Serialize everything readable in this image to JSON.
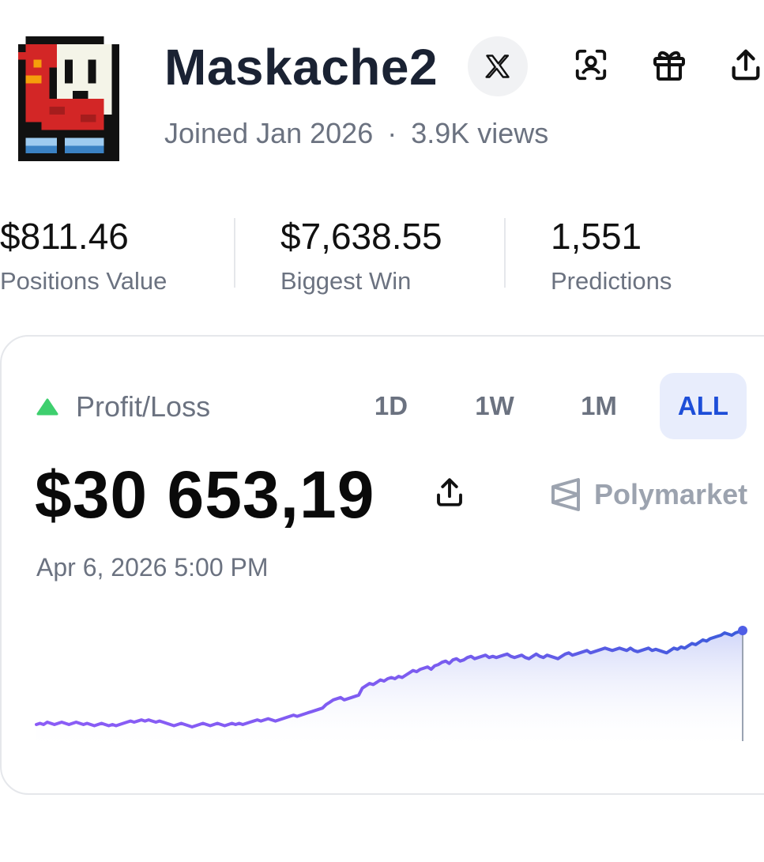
{
  "profile": {
    "username": "Maskache2",
    "joined": "Joined Jan 2026",
    "separator": "·",
    "views": "3.9K views",
    "avatar": "pixel-art-shy-guy-avatar",
    "icons": [
      "x-logo-icon",
      "scan-profile-icon",
      "gift-icon",
      "share-icon"
    ]
  },
  "stats": [
    {
      "value": "$811.46",
      "label": "Positions Value"
    },
    {
      "value": "$7,638.55",
      "label": "Biggest Win"
    },
    {
      "value": "1,551",
      "label": "Predictions"
    }
  ],
  "pnl": {
    "label": "Profit/Loss",
    "trend": "up",
    "value": "$30 653,19",
    "date": "Apr 6, 2026 5:00 PM",
    "brand": "Polymarket",
    "ranges": [
      "1D",
      "1W",
      "1M",
      "ALL"
    ],
    "active_range": "ALL",
    "colors": {
      "up": "#3ecf6e",
      "line_start": "#8b5cf6",
      "line_end": "#3b5bdb",
      "active_tab_bg": "#e8edfc",
      "active_tab_text": "#1d4ed8"
    }
  },
  "chart_data": {
    "type": "area",
    "y": [
      100,
      101,
      100,
      102,
      101,
      100,
      101,
      102,
      101,
      100,
      101,
      102,
      101,
      100,
      101,
      100,
      99,
      100,
      101,
      100,
      99,
      100,
      99,
      100,
      101,
      102,
      103,
      102,
      103,
      104,
      103,
      104,
      103,
      102,
      103,
      102,
      101,
      100,
      99,
      100,
      101,
      100,
      99,
      98,
      99,
      100,
      101,
      100,
      99,
      100,
      101,
      100,
      99,
      100,
      101,
      100,
      101,
      100,
      101,
      102,
      103,
      104,
      103,
      104,
      105,
      104,
      103,
      104,
      105,
      106,
      107,
      108,
      107,
      108,
      109,
      110,
      111,
      112,
      113,
      114,
      117,
      119,
      121,
      122,
      123,
      121,
      122,
      123,
      124,
      125,
      131,
      133,
      135,
      134,
      136,
      138,
      137,
      139,
      140,
      139,
      141,
      140,
      142,
      144,
      146,
      145,
      147,
      148,
      149,
      147,
      150,
      151,
      153,
      154,
      152,
      155,
      156,
      154,
      155,
      157,
      158,
      156,
      157,
      158,
      159,
      157,
      158,
      157,
      158,
      159,
      160,
      158,
      157,
      158,
      159,
      157,
      156,
      158,
      160,
      158,
      157,
      159,
      158,
      157,
      156,
      158,
      160,
      161,
      159,
      160,
      161,
      162,
      163,
      161,
      162,
      163,
      164,
      165,
      164,
      163,
      164,
      165,
      164,
      163,
      165,
      163,
      162,
      163,
      164,
      165,
      163,
      164,
      163,
      162,
      161,
      163,
      165,
      164,
      166,
      165,
      167,
      169,
      168,
      170,
      172,
      171,
      173,
      174,
      175,
      176,
      178,
      177,
      176,
      178,
      179,
      180
    ]
  }
}
